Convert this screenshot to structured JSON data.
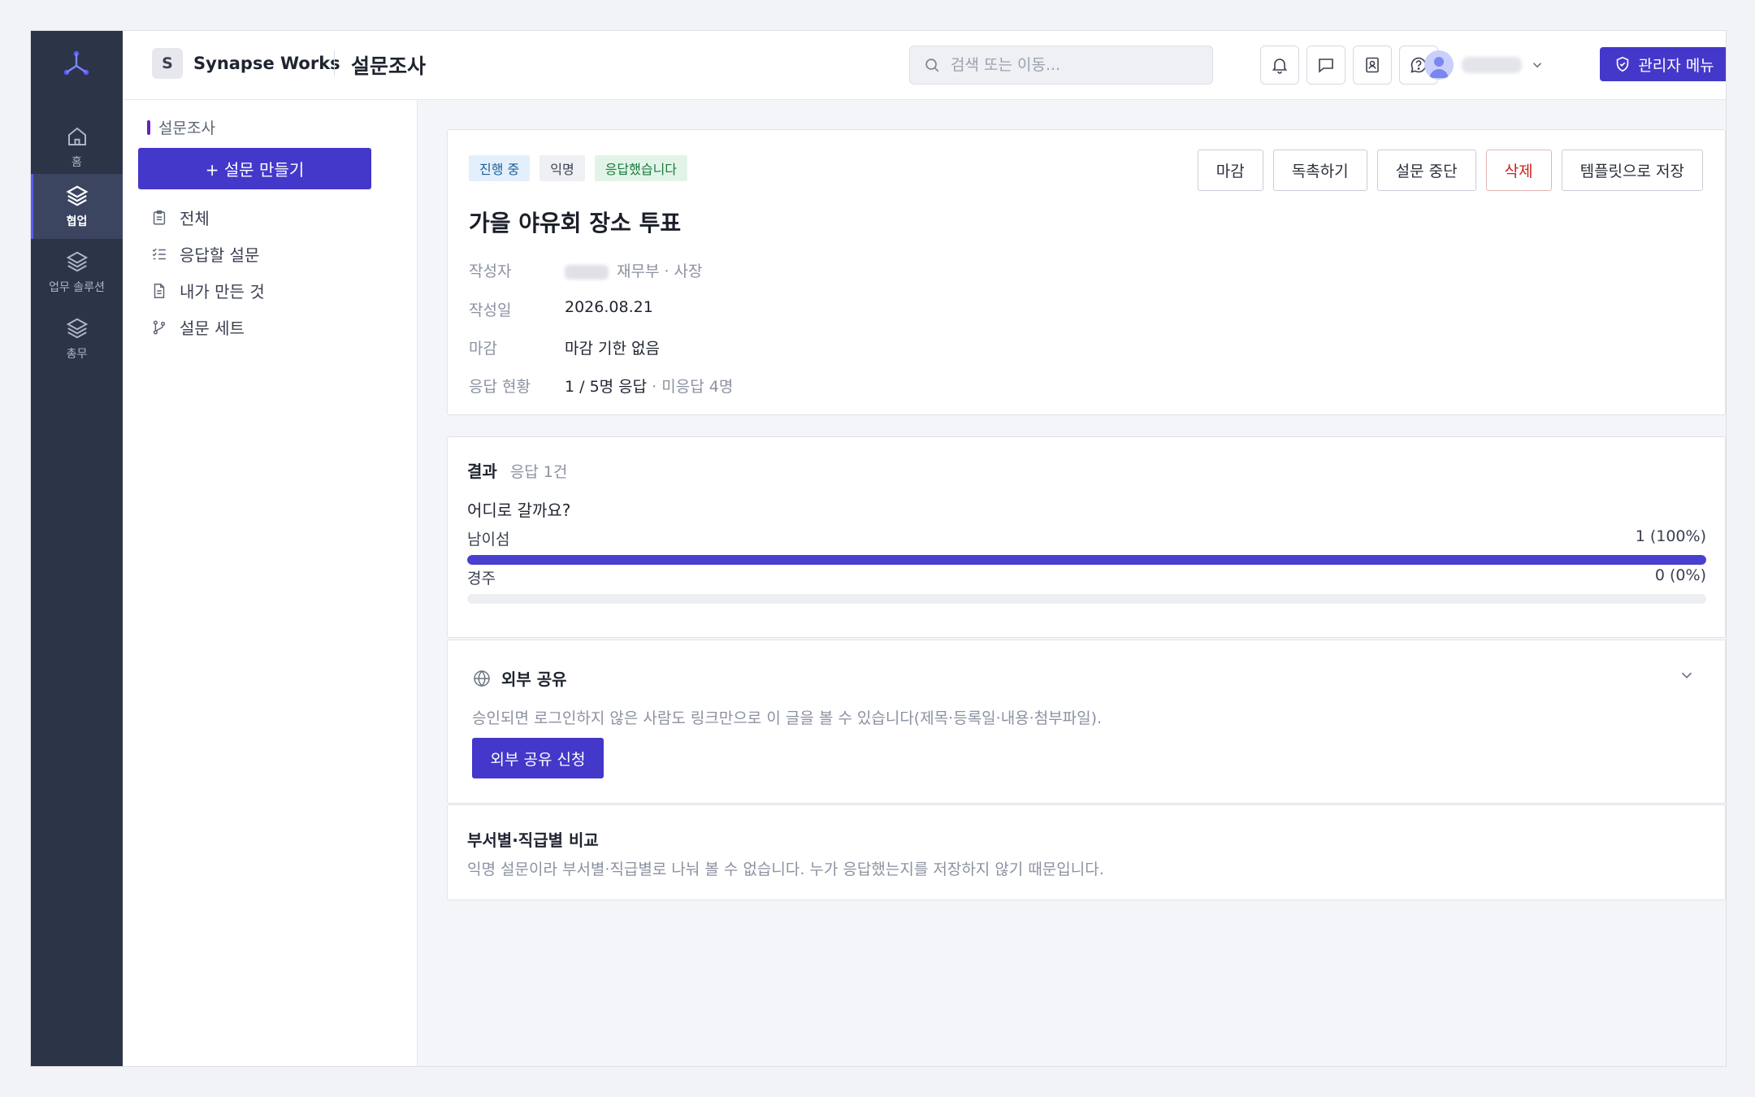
{
  "colors": {
    "accent": "#4438ca",
    "rail_bg": "#2c3448",
    "danger": "#c8231b",
    "badge_progress": "#e3f0fb",
    "badge_responded": "#e2f4e8"
  },
  "rail": {
    "items": [
      {
        "label": "홈",
        "icon": "home-icon"
      },
      {
        "label": "협업",
        "icon": "layers-icon",
        "active": true
      },
      {
        "label": "업무 솔루션",
        "icon": "layers-icon"
      },
      {
        "label": "총무",
        "icon": "layers-icon"
      }
    ]
  },
  "header": {
    "org_initial": "S",
    "org_name": "Synapse Works",
    "page_title": "설문조사",
    "search_placeholder": "검색 또는 이동...",
    "icons": [
      "bell-icon",
      "chat-icon",
      "contacts-icon",
      "help-icon"
    ],
    "admin_label": "관리자 메뉴"
  },
  "subnav": {
    "section": "설문조사",
    "create_label": "+ 설문 만들기",
    "items": [
      {
        "label": "전체",
        "icon": "clipboard-icon"
      },
      {
        "label": "응답할 설문",
        "icon": "checklist-icon"
      },
      {
        "label": "내가 만든 것",
        "icon": "document-icon"
      },
      {
        "label": "설문 세트",
        "icon": "branch-icon"
      }
    ]
  },
  "survey": {
    "badges": [
      "진행 중",
      "익명",
      "응답했습니다"
    ],
    "actions": [
      "마감",
      "독촉하기",
      "설문 중단",
      "삭제",
      "템플릿으로 저장"
    ],
    "title": "가을 야유회 장소 투표",
    "meta": {
      "author_label": "작성자",
      "author_dept": "재무부 · 사장",
      "date_label": "작성일",
      "date": "2026.08.21",
      "deadline_label": "마감",
      "deadline": "마감 기한 없음",
      "status_label": "응답 현황",
      "status": "1 / 5명 응답",
      "status_sub": " · 미응답 4명"
    }
  },
  "results": {
    "title": "결과",
    "count": "응답 1건",
    "question": "어디로 갈까요?",
    "options": [
      {
        "label": "남이섬",
        "value_text": "1 (100%)",
        "fraction": 1.0
      },
      {
        "label": "경주",
        "value_text": "0 (0%)",
        "fraction": 0.0
      }
    ]
  },
  "external_share": {
    "title": "외부 공유",
    "description": "승인되면 로그인하지 않은 사람도 링크만으로 이 글을 볼 수 있습니다(제목·등록일·내용·첨부파일).",
    "button": "외부 공유 신청"
  },
  "comparison": {
    "title": "부서별·직급별 비교",
    "description": "익명 설문이라 부서별·직급별로 나눠 볼 수 없습니다. 누가 응답했는지를 저장하지 않기 때문입니다."
  }
}
